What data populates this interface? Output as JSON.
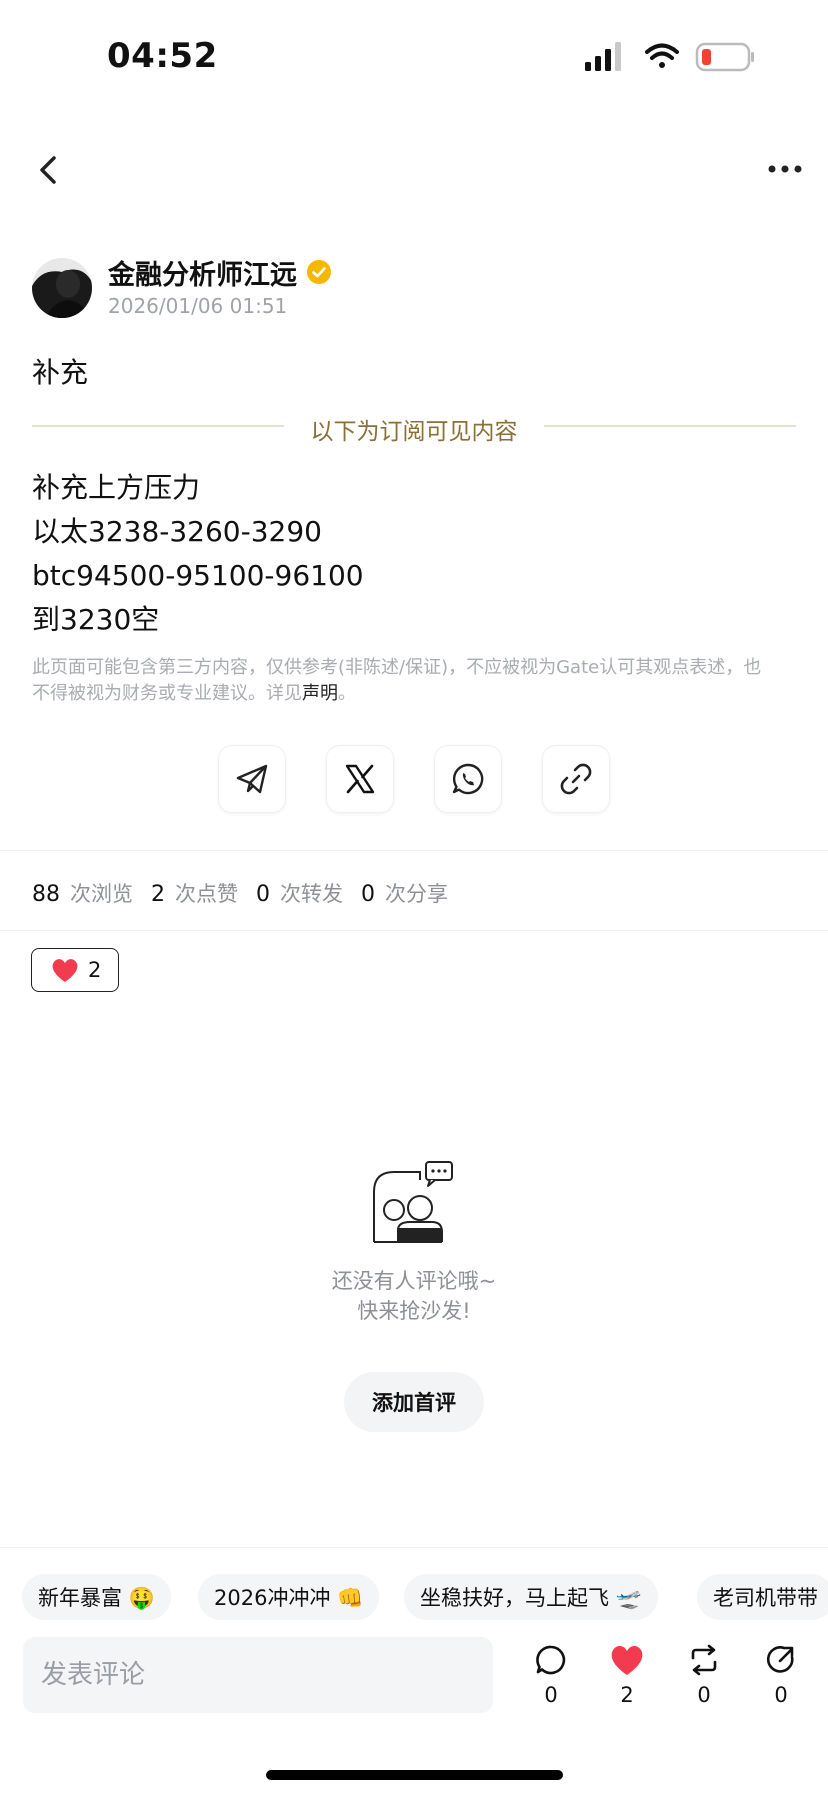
{
  "status_bar": {
    "time": "04:52"
  },
  "author": {
    "name": "金融分析师江远",
    "timestamp": "2026/01/06 01:51"
  },
  "post": {
    "lead": "补充",
    "subscriber_divider": "以下为订阅可见内容",
    "lines": [
      "补充上方压力",
      "以太3238-3260-3290",
      "btc94500-95100-96100",
      "到3230空"
    ],
    "disclaimer": "此页面可能包含第三方内容，仅供参考(非陈述/保证)，不应被视为Gate认可其观点表述，也不得被视为财务或专业建议。详见",
    "disclaimer_link": "声明",
    "disclaimer_end": "。"
  },
  "share": {
    "icons": [
      "telegram-icon",
      "x-icon",
      "whatsapp-icon",
      "link-icon"
    ]
  },
  "stats": [
    {
      "num": "88",
      "label": "次浏览"
    },
    {
      "num": "2",
      "label": "次点赞"
    },
    {
      "num": "0",
      "label": "次转发"
    },
    {
      "num": "0",
      "label": "次分享"
    }
  ],
  "reaction": {
    "emoji": "heart",
    "count": "2"
  },
  "empty": {
    "line1": "还没有人评论哦~",
    "line2": "快来抢沙发!",
    "button": "添加首评"
  },
  "quick_replies": [
    "新年暴富 🤑",
    "2026冲冲冲 👊",
    "坐稳扶好，马上起飞 🛫",
    "老司机带带"
  ],
  "comment": {
    "placeholder": "发表评论"
  },
  "actions": {
    "comment": "0",
    "like": "2",
    "repost": "0",
    "share": "0"
  },
  "colors": {
    "accent_gold": "#8a6f38",
    "heart_red": "#f23b4f",
    "verified_gold": "#f5b800"
  }
}
